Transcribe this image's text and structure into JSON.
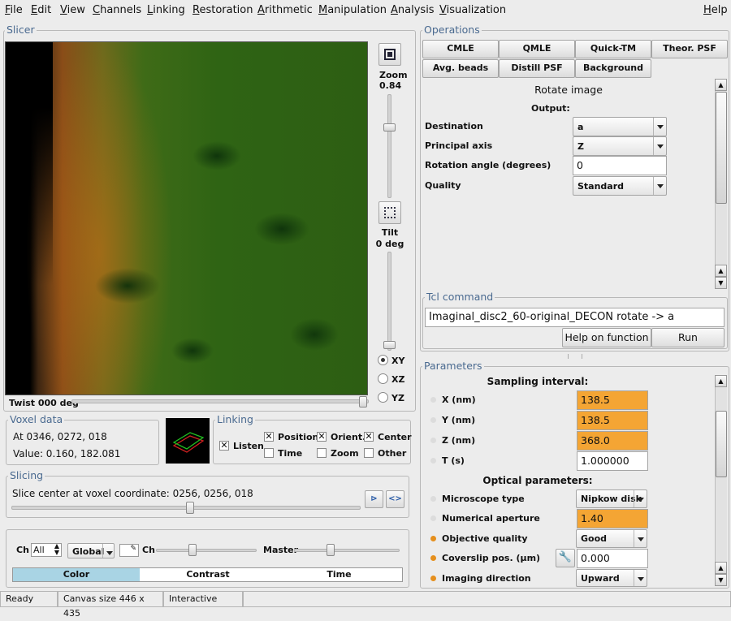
{
  "menu": [
    "File",
    "Edit",
    "View",
    "Channels",
    "Linking",
    "Restoration",
    "Arithmetic",
    "Manipulation",
    "Analysis",
    "Visualization",
    "Help"
  ],
  "slicer": {
    "title": "Slicer",
    "zoom_label": "Zoom",
    "zoom_value": "0.84",
    "tilt_label": "Tilt",
    "tilt_value": "0 deg",
    "views": [
      "XY",
      "XZ",
      "YZ"
    ],
    "selected_view": "XY",
    "twist_label": "Twist 000 deg"
  },
  "voxel": {
    "title": "Voxel data",
    "at": "At 0346, 0272, 018",
    "value": "Value: 0.160, 182.081"
  },
  "linking": {
    "title": "Linking",
    "listen": "Listen",
    "position": "Position",
    "orient": "Orient.",
    "center": "Center",
    "time": "Time",
    "zoom": "Zoom",
    "other": "Other",
    "checked": {
      "listen": true,
      "position": true,
      "orient": true,
      "center": true,
      "time": false,
      "zoom": false,
      "other": false
    }
  },
  "slicing": {
    "title": "Slicing",
    "text": "Slice center at voxel coordinate: 0256, 0256, 018"
  },
  "channels": {
    "ch_label": "Ch",
    "ch_value": "All",
    "mode": "Global",
    "ch2_label": "Ch",
    "master_label": "Master",
    "tabs": [
      "Color",
      "Contrast",
      "Time"
    ],
    "active_tab": "Color"
  },
  "operations": {
    "title": "Operations",
    "buttons_row1": [
      "CMLE",
      "QMLE",
      "Quick-TM",
      "Theor. PSF"
    ],
    "buttons_row2": [
      "Avg. beads",
      "Distill PSF",
      "Background"
    ],
    "panel_title": "Rotate image",
    "output_label": "Output:",
    "fields": [
      {
        "label": "Destination",
        "value": "a",
        "type": "combo"
      },
      {
        "label": "Principal axis",
        "value": "Z",
        "type": "combo"
      },
      {
        "label": "Rotation angle (degrees)",
        "value": "0",
        "type": "entry"
      },
      {
        "label": "Quality",
        "value": "Standard",
        "type": "combo"
      }
    ]
  },
  "tcl": {
    "title": "Tcl command",
    "command": "Imaginal_disc2_60-original_DECON rotate -> a",
    "help_button": "Help on function",
    "run_button": "Run"
  },
  "parameters": {
    "title": "Parameters",
    "sampling_heading": "Sampling interval:",
    "optical_heading": "Optical parameters:",
    "sampling": [
      {
        "label": "X (nm)",
        "value": "138.5",
        "highlight": true
      },
      {
        "label": "Y (nm)",
        "value": "138.5",
        "highlight": true
      },
      {
        "label": "Z (nm)",
        "value": "368.0",
        "highlight": true
      },
      {
        "label": "T (s)",
        "value": "1.000000",
        "highlight": false
      }
    ],
    "optical": [
      {
        "label": "Microscope type",
        "value": "Nipkow disk",
        "type": "combo",
        "bullet": "gray"
      },
      {
        "label": "Numerical aperture",
        "value": "1.40",
        "type": "entry",
        "highlight": true,
        "bullet": "gray"
      },
      {
        "label": "Objective quality",
        "value": "Good",
        "type": "combo",
        "bullet": "orange"
      },
      {
        "label": "Coverslip pos. (µm)",
        "value": "0.000",
        "type": "entry",
        "highlight": false,
        "bullet": "orange"
      },
      {
        "label": "Imaging direction",
        "value": "Upward",
        "type": "combo",
        "bullet": "orange"
      }
    ]
  },
  "statusbar": {
    "ready": "Ready",
    "canvas": "Canvas size 446 x 435",
    "mode": "Interactive"
  },
  "colors": {
    "accent_blue": "#4a6a90",
    "highlight_orange": "#f4a534",
    "bullet_orange": "#e58f1d",
    "tab_active": "#a9d4e4"
  }
}
